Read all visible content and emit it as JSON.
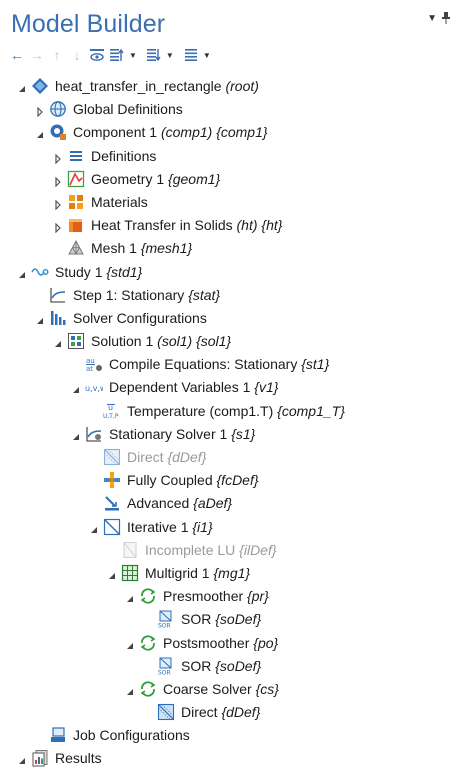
{
  "header": {
    "title": "Model Builder"
  },
  "toolbar": {
    "buttons": [
      "back-arrow",
      "forward-arrow",
      "up-arrow",
      "down-arrow",
      "show-icon",
      "expand-icon",
      "collapse-icon",
      "menu-icon"
    ]
  },
  "tree": [
    {
      "label": "heat_transfer_in_rectangle",
      "tag": "(root)",
      "level": 0,
      "twisty": "expanded",
      "icon": "model-icon"
    },
    {
      "label": "Global Definitions",
      "tag": "",
      "level": 1,
      "twisty": "collapsed",
      "icon": "globe-icon"
    },
    {
      "label": "Component 1",
      "tag": "(comp1) {comp1}",
      "level": 1,
      "twisty": "expanded",
      "icon": "component-icon"
    },
    {
      "label": "Definitions",
      "tag": "",
      "level": 2,
      "twisty": "collapsed",
      "icon": "definitions-icon"
    },
    {
      "label": "Geometry 1",
      "tag": "{geom1}",
      "level": 2,
      "twisty": "collapsed",
      "icon": "geometry-icon"
    },
    {
      "label": "Materials",
      "tag": "",
      "level": 2,
      "twisty": "collapsed",
      "icon": "materials-icon"
    },
    {
      "label": "Heat Transfer in Solids",
      "tag": "(ht) {ht}",
      "level": 2,
      "twisty": "collapsed",
      "icon": "heat-transfer-icon"
    },
    {
      "label": "Mesh 1",
      "tag": "{mesh1}",
      "level": 2,
      "twisty": "none",
      "icon": "mesh-icon"
    },
    {
      "label": "Study 1",
      "tag": "{std1}",
      "level": 0,
      "twisty": "expanded",
      "icon": "study-icon"
    },
    {
      "label": "Step 1: Stationary",
      "tag": "{stat}",
      "level": 1,
      "twisty": "none",
      "icon": "step-icon"
    },
    {
      "label": "Solver Configurations",
      "tag": "",
      "level": 1,
      "twisty": "expanded",
      "icon": "solver-configurations-icon"
    },
    {
      "label": "Solution 1",
      "tag": "(sol1) {sol1}",
      "level": 2,
      "twisty": "expanded",
      "icon": "solution-icon"
    },
    {
      "label": "Compile Equations: Stationary",
      "tag": "{st1}",
      "level": 3,
      "twisty": "none",
      "icon": "compile-equations-icon"
    },
    {
      "label": "Dependent Variables 1",
      "tag": "{v1}",
      "level": 3,
      "twisty": "expanded",
      "icon": "dependent-variables-icon"
    },
    {
      "label": "Temperature (comp1.T)",
      "tag": "{comp1_T}",
      "level": 4,
      "twisty": "none",
      "icon": "temperature-icon"
    },
    {
      "label": "Stationary Solver 1",
      "tag": "{s1}",
      "level": 3,
      "twisty": "expanded",
      "icon": "stationary-solver-icon"
    },
    {
      "label": "Direct",
      "tag": "{dDef}",
      "level": 4,
      "twisty": "none",
      "icon": "direct-icon",
      "disabled": true
    },
    {
      "label": "Fully Coupled",
      "tag": "{fcDef}",
      "level": 4,
      "twisty": "none",
      "icon": "fully-coupled-icon"
    },
    {
      "label": "Advanced",
      "tag": "{aDef}",
      "level": 4,
      "twisty": "none",
      "icon": "advanced-icon"
    },
    {
      "label": "Iterative 1",
      "tag": "{i1}",
      "level": 4,
      "twisty": "expanded",
      "icon": "iterative-icon"
    },
    {
      "label": "Incomplete LU",
      "tag": "{ilDef}",
      "level": 5,
      "twisty": "none",
      "icon": "incomplete-lu-icon",
      "disabled": true
    },
    {
      "label": "Multigrid 1",
      "tag": "{mg1}",
      "level": 5,
      "twisty": "expanded",
      "icon": "multigrid-icon"
    },
    {
      "label": "Presmoother",
      "tag": "{pr}",
      "level": 6,
      "twisty": "expanded",
      "icon": "smoother-icon"
    },
    {
      "label": "SOR",
      "tag": "{soDef}",
      "level": 7,
      "twisty": "none",
      "icon": "sor-icon"
    },
    {
      "label": "Postsmoother",
      "tag": "{po}",
      "level": 6,
      "twisty": "expanded",
      "icon": "smoother-icon"
    },
    {
      "label": "SOR",
      "tag": "{soDef}",
      "level": 7,
      "twisty": "none",
      "icon": "sor-icon"
    },
    {
      "label": "Coarse Solver",
      "tag": "{cs}",
      "level": 6,
      "twisty": "expanded",
      "icon": "smoother-icon"
    },
    {
      "label": "Direct",
      "tag": "{dDef}",
      "level": 7,
      "twisty": "none",
      "icon": "direct-icon"
    },
    {
      "label": "Job Configurations",
      "tag": "",
      "level": 1,
      "twisty": "none",
      "icon": "job-configurations-icon"
    },
    {
      "label": "Results",
      "tag": "",
      "level": 0,
      "twisty": "expanded",
      "icon": "results-icon"
    }
  ]
}
